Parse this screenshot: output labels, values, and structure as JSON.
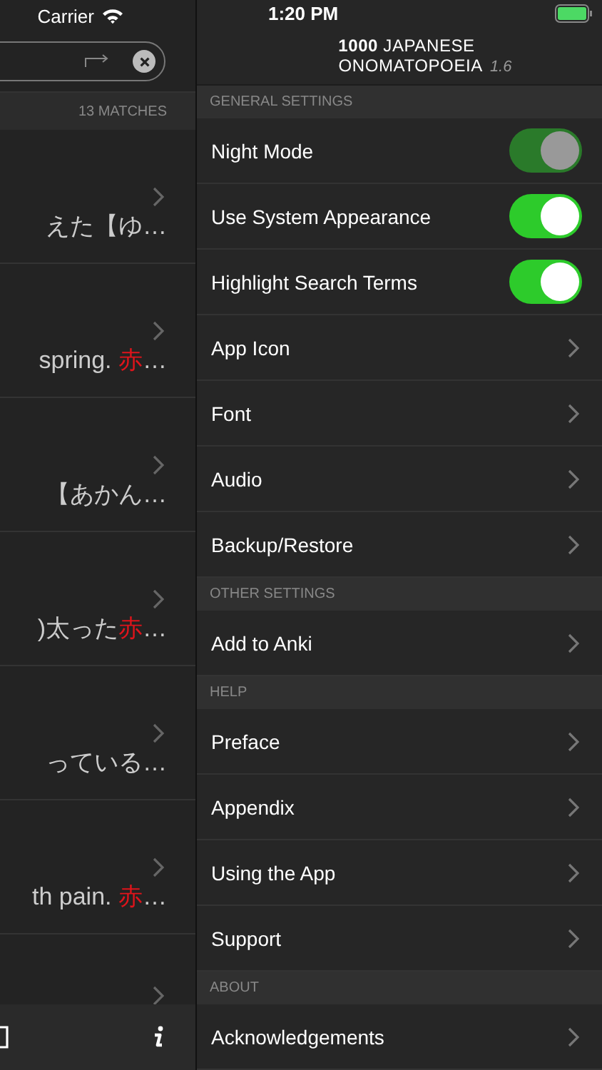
{
  "status_bar": {
    "carrier": "Carrier",
    "time": "1:20 PM"
  },
  "search": {
    "matches": "13 MATCHES"
  },
  "results": [
    {
      "parts": [
        {
          "text": "えた【ゆ…",
          "highlight": false
        }
      ]
    },
    {
      "parts": [
        {
          "text": "spring. ",
          "highlight": false
        },
        {
          "text": "赤",
          "highlight": true
        },
        {
          "text": "…",
          "highlight": false
        }
      ]
    },
    {
      "parts": [
        {
          "text": "【あかん…",
          "highlight": false
        }
      ]
    },
    {
      "parts": [
        {
          "text": ")太った",
          "highlight": false
        },
        {
          "text": "赤",
          "highlight": true
        },
        {
          "text": "…",
          "highlight": false
        }
      ]
    },
    {
      "parts": [
        {
          "text": "っている…",
          "highlight": false
        }
      ]
    },
    {
      "parts": [
        {
          "text": "th pain. ",
          "highlight": false
        },
        {
          "text": "赤",
          "highlight": true
        },
        {
          "text": "…",
          "highlight": false
        }
      ]
    }
  ],
  "app_title": {
    "line_1": "**1000** JAPANESE",
    "line_2": "ONOMATOPOEIA",
    "version": "1.6"
  },
  "sections": [
    {
      "header": "GENERAL SETTINGS",
      "rows": [
        {
          "kind": "toggle",
          "label": "Night Mode",
          "on": true,
          "disabled": true
        },
        {
          "kind": "toggle",
          "label": "Use System Appearance",
          "on": true,
          "disabled": false
        },
        {
          "kind": "toggle",
          "label": "Highlight Search Terms",
          "on": true,
          "disabled": false
        },
        {
          "kind": "link",
          "label": "App Icon"
        },
        {
          "kind": "link",
          "label": "Font"
        },
        {
          "kind": "link",
          "label": "Audio"
        },
        {
          "kind": "link",
          "label": "Backup/Restore"
        }
      ]
    },
    {
      "header": "OTHER SETTINGS",
      "rows": [
        {
          "kind": "link",
          "label": "Add to Anki"
        }
      ]
    },
    {
      "header": "HELP",
      "rows": [
        {
          "kind": "link",
          "label": "Preface"
        },
        {
          "kind": "link",
          "label": "Appendix"
        },
        {
          "kind": "link",
          "label": "Using the App"
        },
        {
          "kind": "link",
          "label": "Support"
        }
      ]
    },
    {
      "header": "ABOUT",
      "rows": [
        {
          "kind": "link",
          "label": "Acknowledgements"
        }
      ]
    }
  ]
}
